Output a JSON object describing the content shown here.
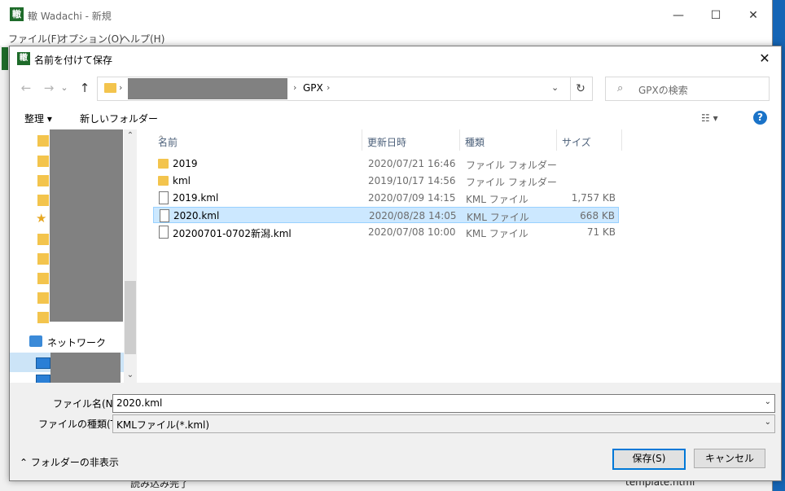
{
  "app": {
    "title": "轍 Wadachi - 新規",
    "icon_glyph": "轍",
    "menu": [
      "ファイル(F)",
      "オプション(O)",
      "ヘルプ(H)"
    ],
    "status_left": "読み込み完了",
    "status_right": "template.html",
    "caption_buttons": [
      "—",
      "☐",
      "✕"
    ]
  },
  "dialog": {
    "title": "名前を付けて保存",
    "icon_glyph": "轍",
    "close": "✕",
    "nav": {
      "back": "←",
      "forward": "→",
      "recent": "⌄",
      "up": "↑"
    },
    "address": {
      "sep": "›",
      "current": "GPX",
      "dropdown": "⌄",
      "refresh": "↻"
    },
    "search": {
      "placeholder": "GPXの検索",
      "icon": "⌕"
    },
    "toolbar": {
      "organize": "整理 ▾",
      "new_folder": "新しいフォルダー",
      "view_icon": "☷ ▾",
      "help": "?"
    },
    "sidebar": {
      "network": "ネットワーク",
      "scroll_up": "⌃",
      "scroll_down": "⌄"
    },
    "columns": {
      "name": "名前",
      "date": "更新日時",
      "type": "種類",
      "size": "サイズ",
      "sort_indicator": "^"
    },
    "files": [
      {
        "name": "2019",
        "date": "2020/07/21 16:46",
        "type": "ファイル フォルダー",
        "size": ""
      },
      {
        "name": "kml",
        "date": "2019/10/17 14:56",
        "type": "ファイル フォルダー",
        "size": ""
      },
      {
        "name": "2019.kml",
        "date": "2020/07/09 14:15",
        "type": "KML ファイル",
        "size": "1,757 KB"
      },
      {
        "name": "2020.kml",
        "date": "2020/08/28 14:05",
        "type": "KML ファイル",
        "size": "668 KB"
      },
      {
        "name": "20200701-0702新潟.kml",
        "date": "2020/07/08 10:00",
        "type": "KML ファイル",
        "size": "71 KB"
      }
    ],
    "filename_label": "ファイル名(N):",
    "filename_value": "2020.kml",
    "filetype_label": "ファイルの種類(T):",
    "filetype_value": "KMLファイル(*.kml)",
    "dropdown_glyph": "⌄",
    "hide_folders": "⌃  フォルダーの非表示",
    "save": "保存(S)",
    "cancel": "キャンセル"
  },
  "colors": {
    "selection": "#cce8ff",
    "accent": "#0078d7",
    "folder": "#f3c44d",
    "app_green": "#1e6b2a"
  }
}
